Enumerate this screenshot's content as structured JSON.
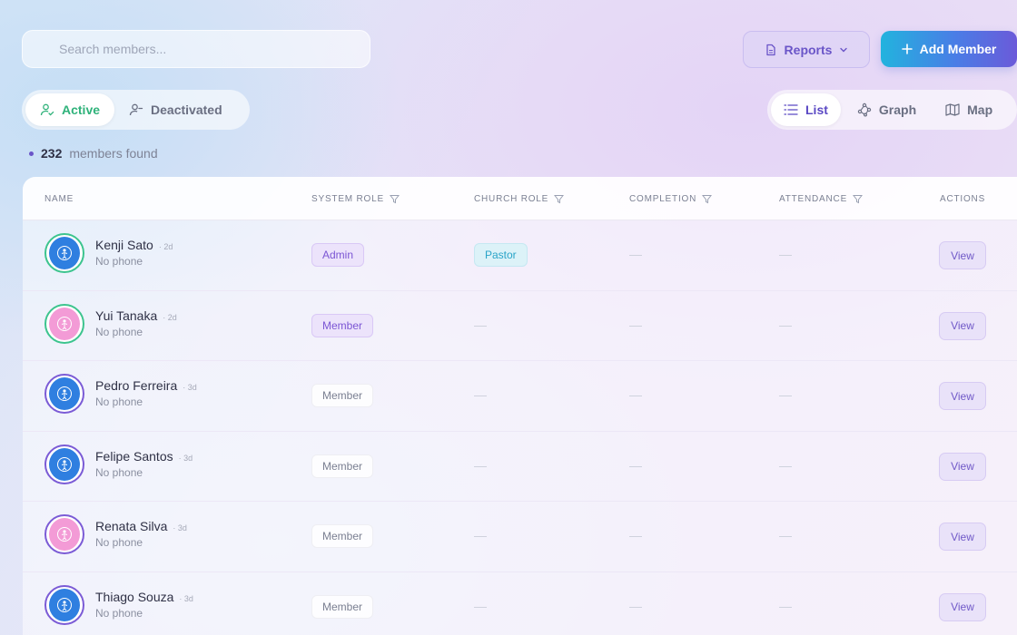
{
  "search": {
    "placeholder": "Search members..."
  },
  "toolbar": {
    "reports_label": "Reports",
    "add_member_label": "Add Member"
  },
  "status_tabs": [
    {
      "label": "Active",
      "selected": true
    },
    {
      "label": "Deactivated",
      "selected": false
    }
  ],
  "view_tabs": [
    {
      "label": "List",
      "selected": true
    },
    {
      "label": "Graph",
      "selected": false
    },
    {
      "label": "Map",
      "selected": false
    }
  ],
  "results": {
    "count": "232",
    "suffix": "members found"
  },
  "table": {
    "headers": {
      "name": "NAME",
      "system_role": "SYSTEM ROLE",
      "church_role": "CHURCH ROLE",
      "completion": "COMPLETION",
      "attendance": "ATTENDANCE",
      "actions": "ACTIONS"
    },
    "rows": [
      {
        "name": "Kenji Sato",
        "ago": "2d",
        "phone": "No phone",
        "system_role": "Admin",
        "church_role": "Pastor",
        "action": "View"
      },
      {
        "name": "Yui Tanaka",
        "ago": "2d",
        "phone": "No phone",
        "system_role": "Member",
        "church_role": "",
        "action": "View"
      },
      {
        "name": "Pedro Ferreira",
        "ago": "3d",
        "phone": "No phone",
        "system_role": "Member",
        "church_role": "",
        "action": "View"
      },
      {
        "name": "Felipe Santos",
        "ago": "3d",
        "phone": "No phone",
        "system_role": "Member",
        "church_role": "",
        "action": "View"
      },
      {
        "name": "Renata Silva",
        "ago": "3d",
        "phone": "No phone",
        "system_role": "Member",
        "church_role": "",
        "action": "View"
      },
      {
        "name": "Thiago Souza",
        "ago": "3d",
        "phone": "No phone",
        "system_role": "Member",
        "church_role": "",
        "action": "View"
      }
    ]
  },
  "colors": {
    "accent": "#6a55c8",
    "active_green": "#2fb27a",
    "avatar_blue": "#2f7fe0",
    "avatar_pink": "#f39bd6",
    "ring_green": "#3cc48e",
    "ring_purple": "#7b5bd6"
  },
  "icons": {
    "search": "search-icon",
    "reports": "document-icon",
    "add": "plus-icon",
    "active": "user-check-icon",
    "deactivated": "user-minus-icon",
    "list": "list-icon",
    "graph": "graph-icon",
    "map": "map-icon",
    "filter": "filter-icon",
    "avatar": "person-icon"
  }
}
